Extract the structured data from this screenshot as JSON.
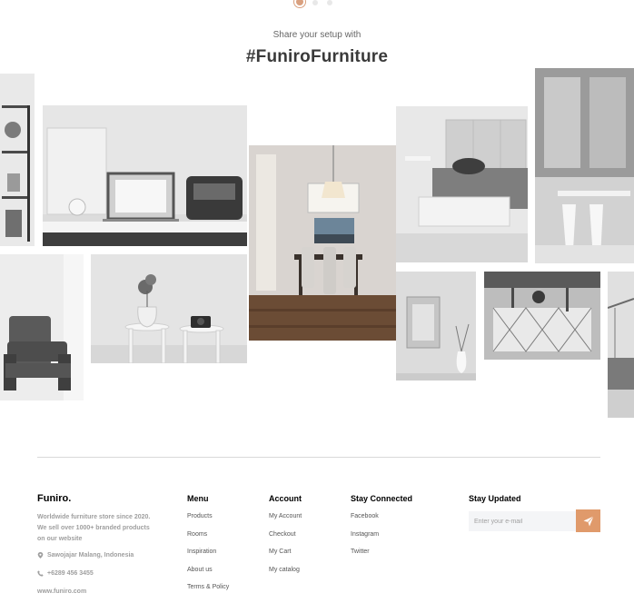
{
  "carousel": {
    "dot_count": 3,
    "active_index": 0
  },
  "gallery": {
    "subtitle": "Share your setup with",
    "hashtag": "#FuniroFurniture"
  },
  "footer": {
    "brand": "Funiro.",
    "about": "Worldwide furniture store since 2020. We sell over 1000+ branded products on our website",
    "address": "Sawojajar Malang, Indonesia",
    "phone": "+6289 456 3455",
    "website": "www.funiro.com",
    "menu": {
      "heading": "Menu",
      "links": [
        "Products",
        "Rooms",
        "Inspiration",
        "About us",
        "Terms & Policy"
      ]
    },
    "account": {
      "heading": "Account",
      "links": [
        "My Account",
        "Checkout",
        "My Cart",
        "My catalog"
      ]
    },
    "stay_connected": {
      "heading": "Stay Connected",
      "links": [
        "Facebook",
        "Instagram",
        "Twitter"
      ]
    },
    "stay_updated": {
      "heading": "Stay Updated",
      "placeholder": "Enter your e-mail"
    }
  },
  "colors": {
    "accent": "#e09a6b",
    "text_muted": "#9f9f9f"
  },
  "icons": {
    "address": "location-pin-icon",
    "phone": "phone-icon",
    "send": "send-icon"
  }
}
